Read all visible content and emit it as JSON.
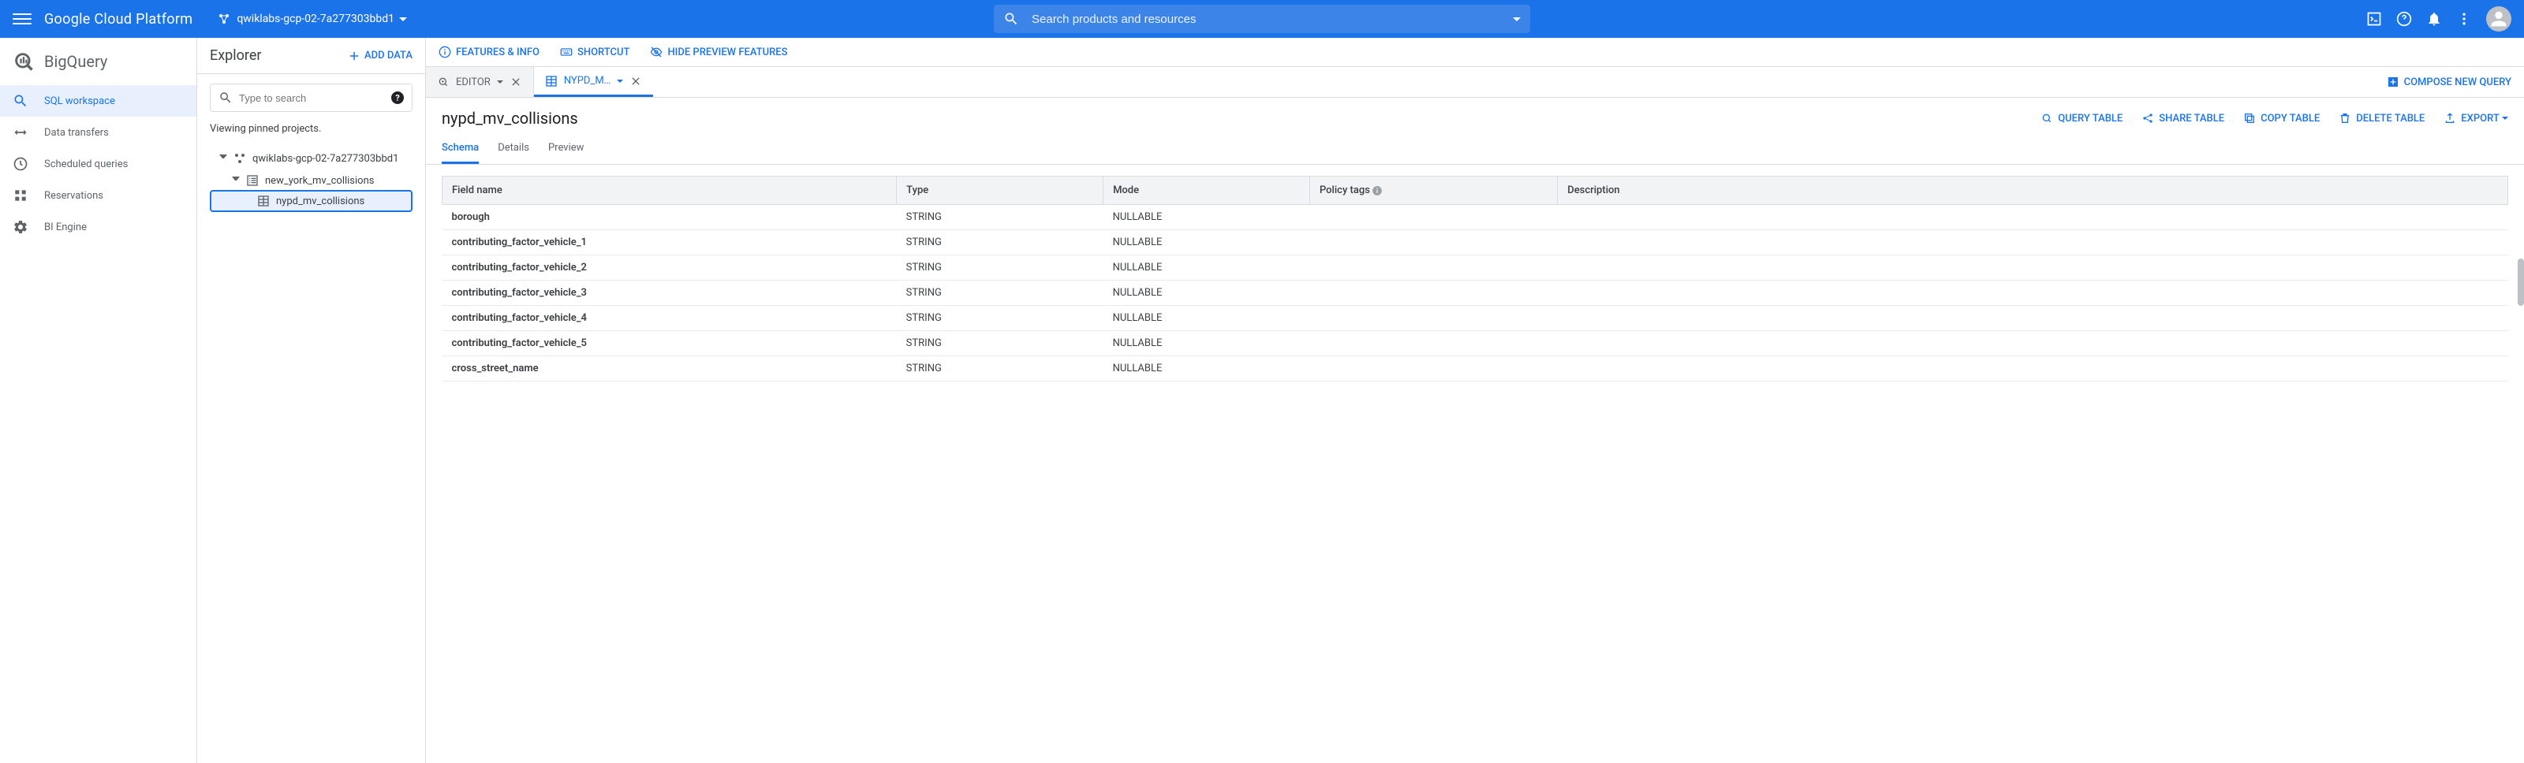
{
  "header": {
    "gcp_title": "Google Cloud Platform",
    "project_name": "qwiklabs-gcp-02-7a277303bbd1",
    "search_placeholder": "Search products and resources"
  },
  "product": {
    "title": "BigQuery",
    "nav": [
      {
        "label": "SQL workspace"
      },
      {
        "label": "Data transfers"
      },
      {
        "label": "Scheduled queries"
      },
      {
        "label": "Reservations"
      },
      {
        "label": "BI Engine"
      }
    ]
  },
  "feature_bar": {
    "features_info": "FEATURES & INFO",
    "shortcut": "SHORTCUT",
    "hide_preview": "HIDE PREVIEW FEATURES"
  },
  "explorer": {
    "title": "Explorer",
    "add_data": "ADD DATA",
    "search_placeholder": "Type to search",
    "pinned_text": "Viewing pinned projects.",
    "tree": {
      "project": "qwiklabs-gcp-02-7a277303bbd1",
      "dataset": "new_york_mv_collisions",
      "table": "nypd_mv_collisions"
    }
  },
  "tabs": {
    "editor": "EDITOR",
    "table_tab": "NYPD_M…",
    "compose": "COMPOSE NEW QUERY"
  },
  "table_panel": {
    "title": "nypd_mv_collisions",
    "actions": {
      "query": "QUERY TABLE",
      "share": "SHARE TABLE",
      "copy": "COPY TABLE",
      "delete": "DELETE TABLE",
      "export": "EXPORT"
    },
    "subtabs": {
      "schema": "Schema",
      "details": "Details",
      "preview": "Preview"
    },
    "columns": {
      "field": "Field name",
      "type": "Type",
      "mode": "Mode",
      "policy": "Policy tags",
      "desc": "Description"
    },
    "rows": [
      {
        "name": "borough",
        "type": "STRING",
        "mode": "NULLABLE"
      },
      {
        "name": "contributing_factor_vehicle_1",
        "type": "STRING",
        "mode": "NULLABLE"
      },
      {
        "name": "contributing_factor_vehicle_2",
        "type": "STRING",
        "mode": "NULLABLE"
      },
      {
        "name": "contributing_factor_vehicle_3",
        "type": "STRING",
        "mode": "NULLABLE"
      },
      {
        "name": "contributing_factor_vehicle_4",
        "type": "STRING",
        "mode": "NULLABLE"
      },
      {
        "name": "contributing_factor_vehicle_5",
        "type": "STRING",
        "mode": "NULLABLE"
      },
      {
        "name": "cross_street_name",
        "type": "STRING",
        "mode": "NULLABLE"
      }
    ]
  }
}
